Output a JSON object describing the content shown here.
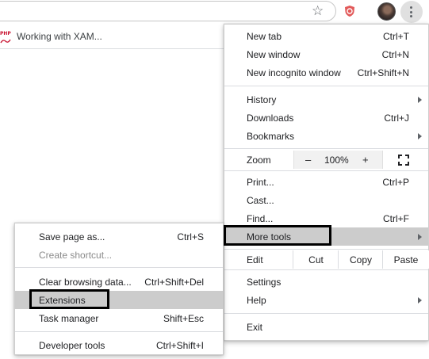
{
  "toolbar": {
    "star_icon": "bookmark-star-icon",
    "extension_icon": "shield-extension-icon",
    "avatar_icon": "profile-avatar",
    "menu_icon": "kebab-menu-icon"
  },
  "bookmarks": {
    "items": [
      {
        "label": "Working with XAM...",
        "icon": "php-favicon"
      }
    ]
  },
  "main_menu": {
    "new_tab": {
      "label": "New tab",
      "shortcut": "Ctrl+T"
    },
    "new_window": {
      "label": "New window",
      "shortcut": "Ctrl+N"
    },
    "new_incognito": {
      "label": "New incognito window",
      "shortcut": "Ctrl+Shift+N"
    },
    "history": {
      "label": "History"
    },
    "downloads": {
      "label": "Downloads",
      "shortcut": "Ctrl+J"
    },
    "bookmarks": {
      "label": "Bookmarks"
    },
    "zoom": {
      "label": "Zoom",
      "minus": "–",
      "value": "100%",
      "plus": "+"
    },
    "print": {
      "label": "Print...",
      "shortcut": "Ctrl+P"
    },
    "cast": {
      "label": "Cast..."
    },
    "find": {
      "label": "Find...",
      "shortcut": "Ctrl+F"
    },
    "more_tools": {
      "label": "More tools"
    },
    "edit": {
      "label": "Edit",
      "cut": "Cut",
      "copy": "Copy",
      "paste": "Paste"
    },
    "settings": {
      "label": "Settings"
    },
    "help": {
      "label": "Help"
    },
    "exit": {
      "label": "Exit"
    }
  },
  "sub_menu": {
    "save_page": {
      "label": "Save page as...",
      "shortcut": "Ctrl+S"
    },
    "create_shortcut": {
      "label": "Create shortcut..."
    },
    "clear_browsing": {
      "label": "Clear browsing data...",
      "shortcut": "Ctrl+Shift+Del"
    },
    "extensions": {
      "label": "Extensions"
    },
    "task_manager": {
      "label": "Task manager",
      "shortcut": "Shift+Esc"
    },
    "developer_tools": {
      "label": "Developer tools",
      "shortcut": "Ctrl+Shift+I"
    }
  },
  "colors": {
    "highlight": "#cccccc",
    "separator": "#dadce0",
    "annotation_outline": "#000000",
    "extension_red": "#e25a5a"
  }
}
